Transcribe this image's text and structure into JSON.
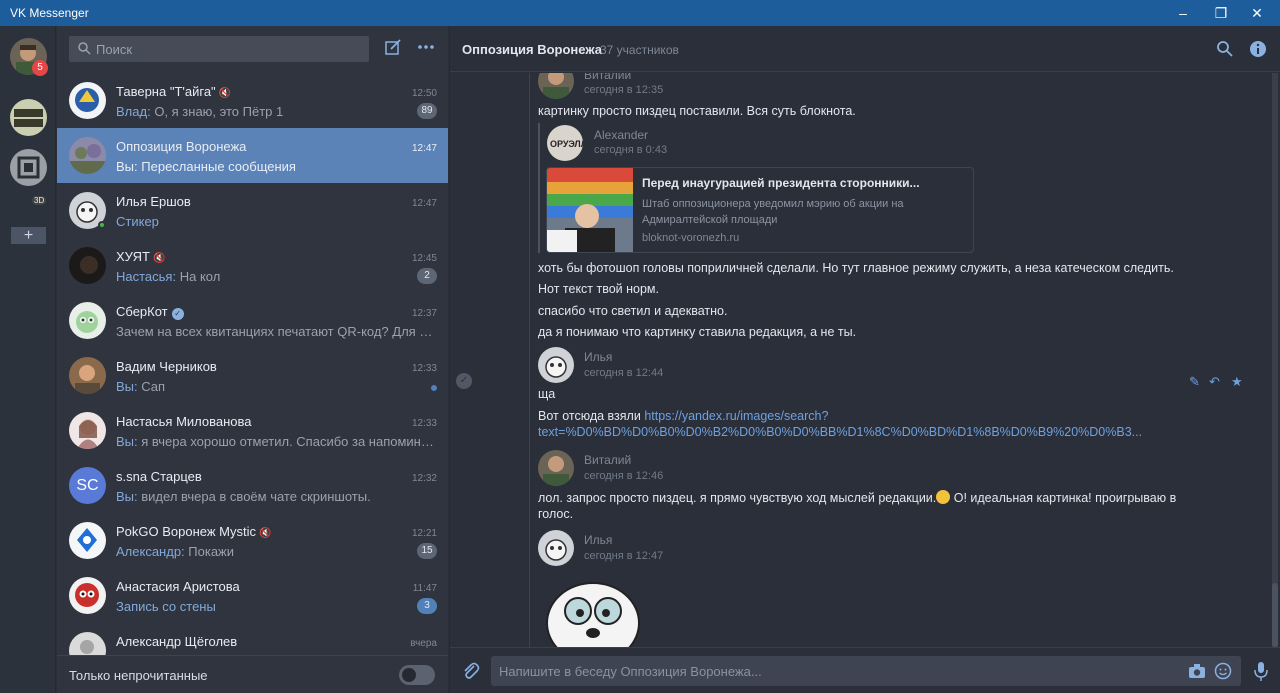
{
  "app": {
    "title": "VK Messenger"
  },
  "rail": {
    "badge": "5",
    "label_3d": "3D",
    "add": "+"
  },
  "search": {
    "placeholder": "Поиск"
  },
  "dialogs": [
    {
      "name": "Таверна \"Т'айга\"",
      "muted": true,
      "who": "Влад:",
      "preview": "О, я знаю, это Пётр 1",
      "time": "12:50",
      "count": "89"
    },
    {
      "name": "Оппозиция Воронежа",
      "who": "Вы:",
      "preview": "Пересланные сообщения",
      "time": "12:47",
      "active": true
    },
    {
      "name": "Илья Ершов",
      "who": "",
      "preview": "Стикер",
      "time": "12:47",
      "online": true
    },
    {
      "name": "ХУЯТ",
      "muted": true,
      "who": "Настасья:",
      "preview": "На кол",
      "time": "12:45",
      "count": "2"
    },
    {
      "name": "СберКот",
      "verified": true,
      "who": "",
      "preview": "Зачем на всех квитанциях печатают QR-код? Для быст...",
      "time": "12:37"
    },
    {
      "name": "Вадим Черников",
      "who": "Вы:",
      "preview": "Сап",
      "time": "12:33",
      "unread_dot": true
    },
    {
      "name": "Настасья Милованова",
      "who": "Вы:",
      "preview": "я вчера хорошо отметил. Спасибо за напоминание.",
      "time": "12:33"
    },
    {
      "name": "s.sna Старцев",
      "avatar_text": "SC",
      "who": "Вы:",
      "preview": "видел вчера в своём чате скриншоты.",
      "time": "12:32"
    },
    {
      "name": "PokGO Воронеж Mystic",
      "muted": true,
      "who": "Александр:",
      "preview": "Покажи",
      "time": "12:21",
      "count": "15"
    },
    {
      "name": "Анастасия Аристова",
      "who": "",
      "preview": "Запись со стены",
      "time": "11:47",
      "count": "3"
    },
    {
      "name": "Александр Щёголев",
      "who": "",
      "preview": "",
      "time": "вчера"
    }
  ],
  "bottom": {
    "unread_only_label": "Только непрочитанные"
  },
  "chat": {
    "title": "Оппозиция Воронежа",
    "subtitle": "37 участников",
    "messages": {
      "m1_name": "Виталий",
      "m1_time": "сегодня в 12:35",
      "m1_text": "картинку просто пиздец поставили. Вся суть блокнота.",
      "fwd_name": "Alexander",
      "fwd_time": "сегодня в 0:43",
      "card_title": "Перед инаугурацией президента сторонники...",
      "card_desc": "Штаб оппозиционера уведомил мэрию об акции на Адмиралтейской площади",
      "card_source": "bloknot-voronezh.ru",
      "t1": "хоть бы фотошоп головы поприличней сделали. Но тут главное режиму служить, а неза катеческом следить.",
      "t2": "Нот текст твой норм.",
      "t3": "спасибо что светил и адекватно.",
      "t4": "да я понимаю что картинку ставила редакция, а не ты.",
      "m2_name": "Илья",
      "m2_time": "сегодня в 12:44",
      "m2_text": "ща",
      "m2_link_prefix": "Вот отсюда взяли",
      "m2_link_1": "https://yandex.ru/images/search?",
      "m2_link_2": "text=%D0%BD%D0%B0%D0%B2%D0%B0%D0%BB%D1%8C%D0%BD%D1%8B%D0%B9%20%D0%B3...",
      "m3_name": "Виталий",
      "m3_time": "сегодня в 12:46",
      "m3_text_1": "лол. запрос просто пиздец. я прямо чувствую ход мыслей редакции.",
      "m3_text_1b": " О! идеальная картинка! проигрываю в",
      "m3_text_2": "голос.",
      "m4_name": "Илья",
      "m4_time": "сегодня в 12:47"
    }
  },
  "composer": {
    "placeholder": "Напишите в беседу Оппозиция Воронежа..."
  },
  "colors": {
    "accent": "#5181b8",
    "titlebar": "#1d5d9b",
    "active_dialog": "#5c83b8",
    "link": "#6ea1de"
  }
}
